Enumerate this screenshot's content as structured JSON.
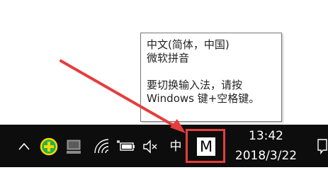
{
  "tooltip": {
    "lines": [
      "中文(简体，中国)",
      "微软拼音",
      "要切换输入法，请按",
      "Windows 键+空格键。"
    ]
  },
  "taskbar": {
    "tray_icons": [
      "chevron-up-icon",
      "green-plus-circle-icon",
      "computer-icon",
      "wifi-icon",
      "battery-plug-icon",
      "speaker-muted-icon"
    ],
    "ime_language": "中",
    "ime_mode": "M",
    "clock": {
      "time": "13:42",
      "date": "2018/3/22"
    },
    "notification_icon": "action-center-icon"
  },
  "colors": {
    "taskbar_bg": "#0d0d0d",
    "highlight": "#e53d3d",
    "tray_green": "#22b14c",
    "tray_yellow": "#f6d800"
  }
}
